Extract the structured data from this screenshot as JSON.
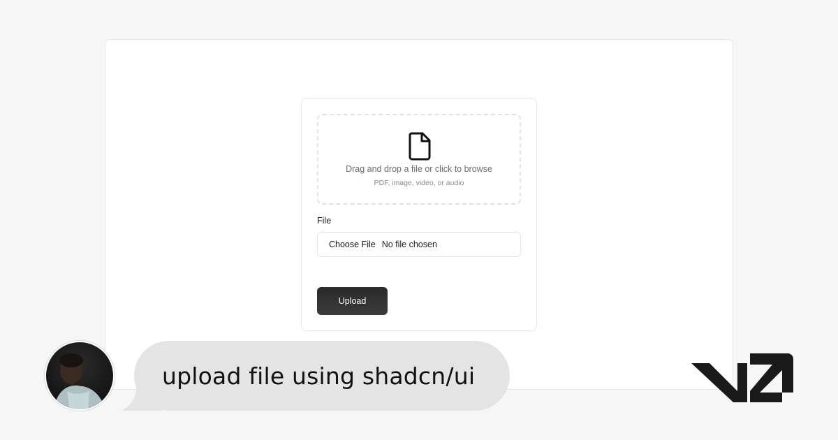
{
  "upload_card": {
    "dropzone": {
      "icon": "file-icon",
      "title": "Drag and drop a file or click to browse",
      "hint": "PDF, image, video, or audio"
    },
    "file_field": {
      "label": "File",
      "choose_button_label": "Choose File",
      "status_text": "No file chosen"
    },
    "upload_button_label": "Upload"
  },
  "chat": {
    "avatar": "user-avatar",
    "prompt": "upload file using shadcn/ui"
  },
  "branding": {
    "logo": "v0-logo"
  },
  "colors": {
    "page_background": "#f6f6f6",
    "bubble_background": "#e4e4e4",
    "button_background": "#2f2f2f",
    "logo": "#1a1a1a"
  }
}
